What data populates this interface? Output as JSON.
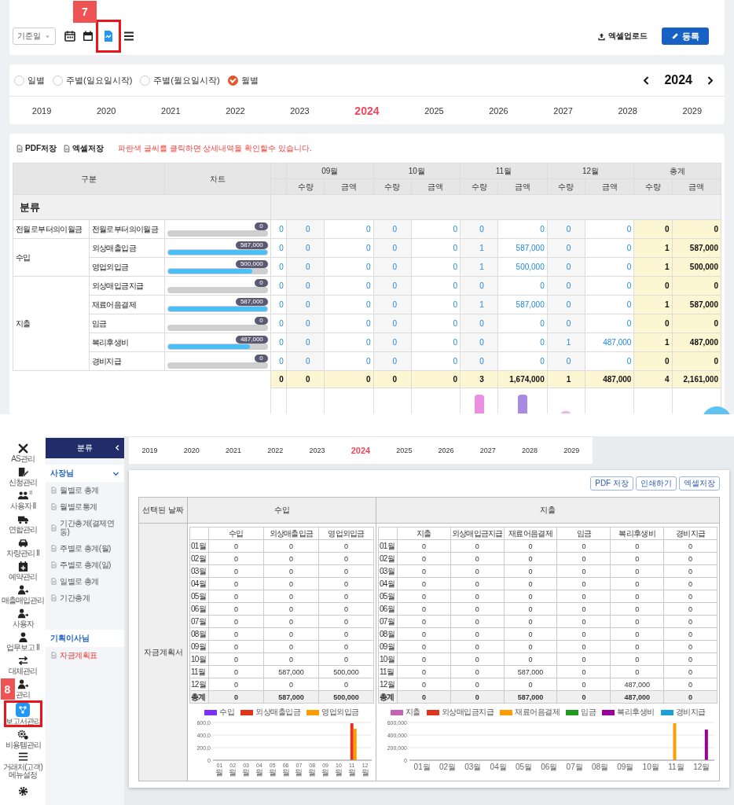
{
  "toolbar": {
    "date_filter": "기준일",
    "view_icons": [
      {
        "kind": "calendar",
        "selected": false
      },
      {
        "kind": "calendar-week",
        "selected": false
      },
      {
        "kind": "chart-doc",
        "selected": true,
        "callout": "7"
      },
      {
        "kind": "list",
        "selected": false
      }
    ],
    "upload_link": "엑셀업로드",
    "register_button": "등록"
  },
  "period": {
    "options": [
      {
        "label": "일별",
        "selected": false
      },
      {
        "label": "주별(일요일시작)",
        "selected": false
      },
      {
        "label": "주별(월요일시작)",
        "selected": false
      },
      {
        "label": "월별",
        "selected": true
      }
    ],
    "year": "2024",
    "years": [
      {
        "label": "2019",
        "selected": false
      },
      {
        "label": "2020",
        "selected": false
      },
      {
        "label": "2021",
        "selected": false
      },
      {
        "label": "2022",
        "selected": false
      },
      {
        "label": "2023",
        "selected": false
      },
      {
        "label": "2024",
        "selected": true
      },
      {
        "label": "2025",
        "selected": false
      },
      {
        "label": "2026",
        "selected": false
      },
      {
        "label": "2027",
        "selected": false
      },
      {
        "label": "2028",
        "selected": false
      },
      {
        "label": "2029",
        "selected": false
      }
    ]
  },
  "report": {
    "actions": [
      "PDF저장",
      "엑셀저장"
    ],
    "notice": "파란색 글씨를 클릭하면 상세내역을 확인할수 있습니다.",
    "table": {
      "group_header": "구분",
      "chart_header": "차트",
      "column_groups": [
        {
          "label": "09월",
          "kind": "month"
        },
        {
          "label": "10월",
          "kind": "month"
        },
        {
          "label": "11월",
          "kind": "month"
        },
        {
          "label": "12월",
          "kind": "month"
        },
        {
          "label": "총계",
          "kind": "total"
        }
      ],
      "sub_headers": [
        "수량",
        "금액",
        "수량",
        "금액",
        "수량",
        "금액",
        "수량",
        "금액",
        "수량",
        "금액"
      ],
      "category_label": "분류",
      "groups": [
        {
          "label": "전월로부터의이월금",
          "rows": [
            {
              "name": "전월로부터의이월금",
              "bar_label": "0",
              "level": 0,
              "cells": [
                "0",
                "0",
                "0",
                "0",
                "0",
                "0",
                "0",
                "0",
                "0",
                "0",
                "0"
              ]
            }
          ]
        },
        {
          "label": "수입",
          "rows": [
            {
              "name": "외상매출입금",
              "bar_label": "587,000",
              "level": 1,
              "cells": [
                "0",
                "0",
                "0",
                "0",
                "0",
                "1",
                "587,000",
                "0",
                "0",
                "1",
                "587,000"
              ]
            },
            {
              "name": "영업외입금",
              "bar_label": "500,000",
              "level": 0.85,
              "cells": [
                "0",
                "0",
                "0",
                "0",
                "0",
                "1",
                "500,000",
                "0",
                "0",
                "1",
                "500,000"
              ]
            }
          ]
        },
        {
          "label": "지출",
          "rows": [
            {
              "name": "외상매입금지급",
              "bar_label": "0",
              "level": 0,
              "cells": [
                "0",
                "0",
                "0",
                "0",
                "0",
                "0",
                "0",
                "0",
                "0",
                "0",
                "0"
              ]
            },
            {
              "name": "재료어음결제",
              "bar_label": "587,000",
              "level": 1,
              "cells": [
                "0",
                "0",
                "0",
                "0",
                "0",
                "1",
                "587,000",
                "0",
                "0",
                "1",
                "587,000"
              ]
            },
            {
              "name": "임금",
              "bar_label": "0",
              "level": 0,
              "cells": [
                "0",
                "0",
                "0",
                "0",
                "0",
                "0",
                "0",
                "0",
                "0",
                "0",
                "0"
              ]
            },
            {
              "name": "복리후생비",
              "bar_label": "487,000",
              "level": 0.83,
              "cells": [
                "0",
                "0",
                "0",
                "0",
                "0",
                "0",
                "0",
                "1",
                "487,000",
                "1",
                "487,000"
              ]
            },
            {
              "name": "경비지급",
              "bar_label": "0",
              "level": 0,
              "cells": [
                "0",
                "0",
                "0",
                "0",
                "0",
                "0",
                "0",
                "0",
                "0",
                "0",
                "0"
              ]
            }
          ]
        }
      ],
      "total_row": [
        "0",
        "0",
        "0",
        "0",
        "0",
        "3",
        "1,674,000",
        "1",
        "487,000",
        "4",
        "2,161,000"
      ]
    }
  },
  "nav_rail": [
    {
      "label": "AS관리",
      "kind": "tools",
      "selected": false
    },
    {
      "label": "신청관리",
      "kind": "doc-pen",
      "selected": false
    },
    {
      "label": "사용자 II",
      "kind": "people",
      "selected": false,
      "marker": "II"
    },
    {
      "label": "연합관리",
      "kind": "truck",
      "selected": false
    },
    {
      "label": "차량관리 II",
      "kind": "car",
      "selected": false
    },
    {
      "label": "예약관리",
      "kind": "calendar-plus",
      "selected": false
    },
    {
      "label": "매출매입관리",
      "kind": "person-arrow",
      "selected": false
    },
    {
      "label": "사용자",
      "kind": "person-arrow",
      "selected": false
    },
    {
      "label": "업무보고 II",
      "kind": "person",
      "selected": false
    },
    {
      "label": "대체관리",
      "kind": "swap",
      "selected": false
    },
    {
      "label": "관리",
      "kind": "person-arrow",
      "selected": false
    },
    {
      "label": "보고서관리",
      "kind": "network",
      "selected": true,
      "callout": "8"
    },
    {
      "label": "비용템관리",
      "kind": "gears",
      "selected": false
    },
    {
      "label": "거래처(고객)메뉴설정",
      "kind": "menu",
      "selected": false
    },
    {
      "kind": "gear",
      "selected": false
    }
  ],
  "sidebar": {
    "title": "분류",
    "sections": [
      {
        "label": "사장님",
        "expanded": true,
        "items": [
          {
            "label": "월별로 총계",
            "selected": false
          },
          {
            "label": "월별로통계",
            "selected": false
          },
          {
            "label": "기간총계(결제연동)",
            "selected": false
          },
          {
            "label": "주별로 총계(월)",
            "selected": false
          },
          {
            "label": "주별로 총계(일)",
            "selected": false
          },
          {
            "label": "일별로 총계",
            "selected": false
          },
          {
            "label": "기간총계",
            "selected": false
          }
        ]
      },
      {
        "label": "기획이사님",
        "items": [
          {
            "label": "자금계획표",
            "selected": true
          }
        ]
      }
    ]
  },
  "plan": {
    "years": [
      {
        "label": "2019",
        "selected": false
      },
      {
        "label": "2020",
        "selected": false
      },
      {
        "label": "2021",
        "selected": false
      },
      {
        "label": "2022",
        "selected": false
      },
      {
        "label": "2023",
        "selected": false
      },
      {
        "label": "2024",
        "selected": true
      },
      {
        "label": "2025",
        "selected": false
      },
      {
        "label": "2026",
        "selected": false
      },
      {
        "label": "2027",
        "selected": false
      },
      {
        "label": "2028",
        "selected": false
      },
      {
        "label": "2029",
        "selected": false
      }
    ],
    "buttons": [
      "PDF 저장",
      "인쇄하기",
      "엑셀저장"
    ],
    "date_header": "선택된 날짜",
    "row_label": "자금계획서",
    "panels": [
      {
        "title": "수입",
        "columns": [
          "수입",
          "외상매출입금",
          "영업외입금"
        ],
        "rows": [
          {
            "month": "01월",
            "values": [
              "0",
              "0",
              "0"
            ]
          },
          {
            "month": "02월",
            "values": [
              "0",
              "0",
              "0"
            ]
          },
          {
            "month": "03월",
            "values": [
              "0",
              "0",
              "0"
            ]
          },
          {
            "month": "04월",
            "values": [
              "0",
              "0",
              "0"
            ]
          },
          {
            "month": "05월",
            "values": [
              "0",
              "0",
              "0"
            ]
          },
          {
            "month": "06월",
            "values": [
              "0",
              "0",
              "0"
            ]
          },
          {
            "month": "07월",
            "values": [
              "0",
              "0",
              "0"
            ]
          },
          {
            "month": "08월",
            "values": [
              "0",
              "0",
              "0"
            ]
          },
          {
            "month": "09월",
            "values": [
              "0",
              "0",
              "0"
            ]
          },
          {
            "month": "10월",
            "values": [
              "0",
              "0",
              "0"
            ]
          },
          {
            "month": "11월",
            "values": [
              "0",
              "587,000",
              "500,000"
            ]
          },
          {
            "month": "12월",
            "values": [
              "0",
              "0",
              "0"
            ]
          }
        ],
        "total": {
          "label": "총계",
          "values": [
            "0",
            "587,000",
            "500,000"
          ]
        },
        "chart_data": {
          "type": "bar",
          "categories": [
            "01월",
            "02월",
            "03월",
            "04월",
            "05월",
            "06월",
            "07월",
            "08월",
            "09월",
            "10월",
            "11월",
            "12월"
          ],
          "series": [
            {
              "name": "수입",
              "color": "#7b2ff7",
              "values": [
                0,
                0,
                0,
                0,
                0,
                0,
                0,
                0,
                0,
                0,
                0,
                0
              ]
            },
            {
              "name": "외상매출입금",
              "color": "#e0341c",
              "values": [
                0,
                0,
                0,
                0,
                0,
                0,
                0,
                0,
                0,
                0,
                587,
                0
              ]
            },
            {
              "name": "영업외입금",
              "color": "#ff9c00",
              "values": [
                0,
                0,
                0,
                0,
                0,
                0,
                0,
                0,
                0,
                0,
                500,
                0
              ]
            }
          ],
          "ylim": [
            0,
            600
          ],
          "yticks": [
            {
              "value": 0,
              "label": "0"
            },
            {
              "value": 200,
              "label": "200,0"
            },
            {
              "value": 400,
              "label": "400,0"
            },
            {
              "value": 600,
              "label": "600,0"
            }
          ],
          "legend": "top"
        }
      },
      {
        "title": "지출",
        "columns": [
          "지출",
          "외상매입금지급",
          "재료어음결제",
          "임금",
          "복리후생비",
          "경비지급"
        ],
        "rows": [
          {
            "month": "01월",
            "values": [
              "0",
              "0",
              "0",
              "0",
              "0",
              "0"
            ]
          },
          {
            "month": "02월",
            "values": [
              "0",
              "0",
              "0",
              "0",
              "0",
              "0"
            ]
          },
          {
            "month": "03월",
            "values": [
              "0",
              "0",
              "0",
              "0",
              "0",
              "0"
            ]
          },
          {
            "month": "04월",
            "values": [
              "0",
              "0",
              "0",
              "0",
              "0",
              "0"
            ]
          },
          {
            "month": "05월",
            "values": [
              "0",
              "0",
              "0",
              "0",
              "0",
              "0"
            ]
          },
          {
            "month": "06월",
            "values": [
              "0",
              "0",
              "0",
              "0",
              "0",
              "0"
            ]
          },
          {
            "month": "07월",
            "values": [
              "0",
              "0",
              "0",
              "0",
              "0",
              "0"
            ]
          },
          {
            "month": "08월",
            "values": [
              "0",
              "0",
              "0",
              "0",
              "0",
              "0"
            ]
          },
          {
            "month": "09월",
            "values": [
              "0",
              "0",
              "0",
              "0",
              "0",
              "0"
            ]
          },
          {
            "month": "10월",
            "values": [
              "0",
              "0",
              "0",
              "0",
              "0",
              "0"
            ]
          },
          {
            "month": "11월",
            "values": [
              "0",
              "0",
              "587,000",
              "0",
              "0",
              "0"
            ]
          },
          {
            "month": "12월",
            "values": [
              "0",
              "0",
              "0",
              "0",
              "487,000",
              "0"
            ]
          }
        ],
        "total": {
          "label": "총계",
          "values": [
            "0",
            "0",
            "587,000",
            "0",
            "487,000",
            "0"
          ]
        },
        "chart_data": {
          "type": "bar",
          "categories": [
            "01월",
            "02월",
            "03월",
            "04월",
            "05월",
            "06월",
            "07월",
            "08월",
            "09월",
            "10월",
            "11월",
            "12월"
          ],
          "series": [
            {
              "name": "지출",
              "color": "#c462b5",
              "values": [
                0,
                0,
                0,
                0,
                0,
                0,
                0,
                0,
                0,
                0,
                0,
                0
              ]
            },
            {
              "name": "외상매입금지급",
              "color": "#e0341c",
              "values": [
                0,
                0,
                0,
                0,
                0,
                0,
                0,
                0,
                0,
                0,
                0,
                0
              ]
            },
            {
              "name": "재료어음결제",
              "color": "#ff9c00",
              "values": [
                0,
                0,
                0,
                0,
                0,
                0,
                0,
                0,
                0,
                0,
                587000,
                0
              ]
            },
            {
              "name": "임금",
              "color": "#1e9a1e",
              "values": [
                0,
                0,
                0,
                0,
                0,
                0,
                0,
                0,
                0,
                0,
                0,
                0
              ]
            },
            {
              "name": "복리후생비",
              "color": "#99009b",
              "values": [
                0,
                0,
                0,
                0,
                0,
                0,
                0,
                0,
                0,
                0,
                0,
                487000
              ]
            },
            {
              "name": "경비지급",
              "color": "#1a9fd6",
              "values": [
                0,
                0,
                0,
                0,
                0,
                0,
                0,
                0,
                0,
                0,
                0,
                0
              ]
            }
          ],
          "ylim": [
            0,
            600000
          ],
          "yticks": [
            {
              "value": 0,
              "label": "0"
            },
            {
              "value": 200000,
              "label": "200,000"
            },
            {
              "value": 400000,
              "label": "400,000"
            },
            {
              "value": 600000,
              "label": "600,000"
            }
          ],
          "legend": "top"
        }
      }
    ]
  }
}
